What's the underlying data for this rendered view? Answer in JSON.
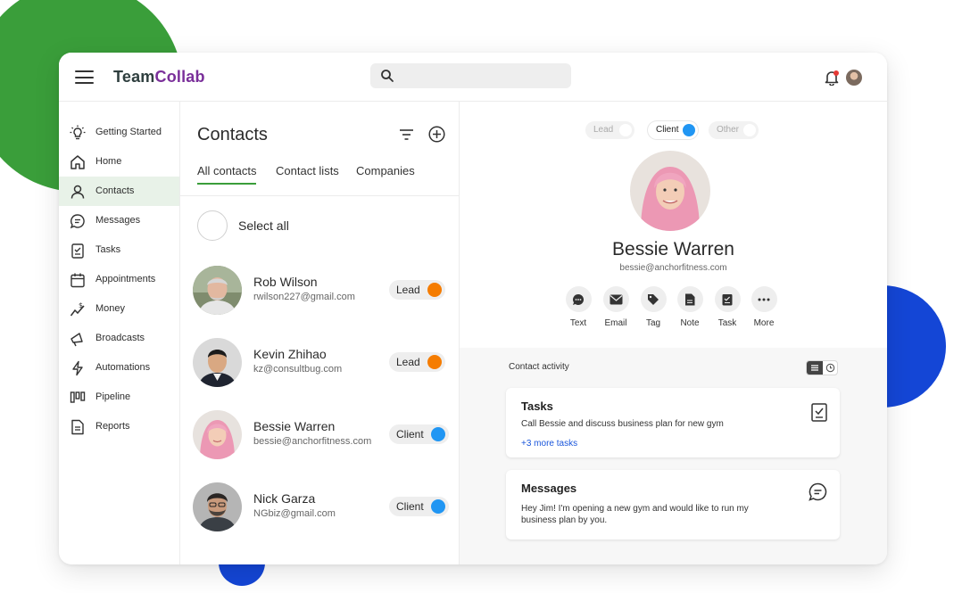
{
  "app": {
    "brand_part1": "Team",
    "brand_part2": "Collab"
  },
  "search": {
    "placeholder": ""
  },
  "sidebar": {
    "items": [
      {
        "label": "Getting Started",
        "icon": "lightbulb-icon"
      },
      {
        "label": "Home",
        "icon": "home-icon"
      },
      {
        "label": "Contacts",
        "icon": "person-icon",
        "active": true
      },
      {
        "label": "Messages",
        "icon": "chat-icon"
      },
      {
        "label": "Tasks",
        "icon": "checklist-icon"
      },
      {
        "label": "Appointments",
        "icon": "calendar-icon"
      },
      {
        "label": "Money",
        "icon": "money-icon"
      },
      {
        "label": "Broadcasts",
        "icon": "megaphone-icon"
      },
      {
        "label": "Automations",
        "icon": "lightning-icon"
      },
      {
        "label": "Pipeline",
        "icon": "pipeline-icon"
      },
      {
        "label": "Reports",
        "icon": "report-icon"
      }
    ]
  },
  "contacts": {
    "title": "Contacts",
    "tabs": [
      "All contacts",
      "Contact lists",
      "Companies"
    ],
    "select_all": "Select all",
    "rows": [
      {
        "name": "Rob Wilson",
        "email": "rwilson227@gmail.com",
        "status": "Lead",
        "status_color": "#f57c00"
      },
      {
        "name": "Kevin Zhihao",
        "email": "kz@consultbug.com",
        "status": "Lead",
        "status_color": "#f57c00"
      },
      {
        "name": "Bessie Warren",
        "email": "bessie@anchorfitness.com",
        "status": "Client",
        "status_color": "#2196f3"
      },
      {
        "name": "Nick Garza",
        "email": "NGbiz@gmail.com",
        "status": "Client",
        "status_color": "#2196f3"
      }
    ]
  },
  "detail": {
    "segments": [
      "Lead",
      "Client",
      "Other"
    ],
    "selected_segment": "Client",
    "name": "Bessie Warren",
    "email": "bessie@anchorfitness.com",
    "actions": [
      "Text",
      "Email",
      "Tag",
      "Note",
      "Task",
      "More"
    ],
    "activity_title": "Contact activity",
    "tasks_card": {
      "title": "Tasks",
      "body": "Call Bessie and discuss business plan for new gym",
      "more": "+3 more tasks"
    },
    "messages_card": {
      "title": "Messages",
      "body": "Hey Jim! I'm opening a new gym and would like to run my business plan by you."
    }
  },
  "colors": {
    "brand_green": "#3a9e3a",
    "brand_purple": "#7a2f9a",
    "accent_blue": "#1446d6",
    "lead_orange": "#f57c00",
    "client_blue": "#2196f3"
  }
}
